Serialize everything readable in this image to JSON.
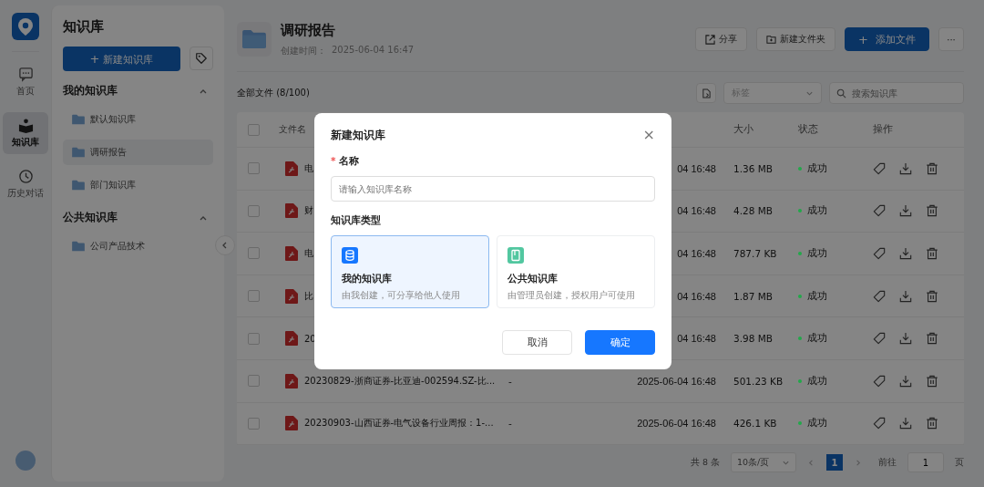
{
  "rail": {
    "items": [
      {
        "label": "首页",
        "selected": false
      },
      {
        "label": "知识库",
        "selected": true
      },
      {
        "label": "历史对话",
        "selected": false
      }
    ]
  },
  "sidebar": {
    "title": "知识库",
    "new_button": "新建知识库",
    "plus": "+",
    "groups": [
      {
        "title": "我的知识库",
        "expanded": true,
        "items": [
          {
            "label": "默认知识库",
            "selected": false
          },
          {
            "label": "调研报告",
            "selected": true
          },
          {
            "label": "部门知识库",
            "selected": false
          }
        ]
      },
      {
        "title": "公共知识库",
        "expanded": true,
        "items": [
          {
            "label": "公司产品技术",
            "selected": false
          }
        ]
      }
    ]
  },
  "header": {
    "title": "调研报告",
    "created_label": "创建时间：",
    "created": "2025-06-04 16:47",
    "share": "分享",
    "new_folder": "新建文件夹",
    "add_file": "添加文件",
    "plus": "+",
    "more": "···"
  },
  "toolbar": {
    "count": "全部文件 (8/100)",
    "tag_select": {
      "placeholder": "标签"
    },
    "search": {
      "placeholder": "搜索知识库"
    }
  },
  "table": {
    "columns": [
      "文件名",
      "大小",
      "状态",
      "操作"
    ],
    "header_checked": false,
    "rows": [
      {
        "checked": false,
        "name": "电",
        "date": "04 16:48",
        "size": "1.36 MB",
        "status": "成功",
        "color": "#22a84a"
      },
      {
        "checked": false,
        "name": "财",
        "date": "04 16:48",
        "size": "4.28 MB",
        "status": "成功",
        "color": "#22a84a"
      },
      {
        "checked": false,
        "name": "电",
        "date": "04 16:48",
        "size": "787.7 KB",
        "status": "成功",
        "color": "#22a84a"
      },
      {
        "checked": false,
        "name": "比",
        "date": "04 16:48",
        "size": "1.87 MB",
        "status": "成功",
        "color": "#22a84a"
      },
      {
        "checked": false,
        "name": "20",
        "date": "04 16:48",
        "size": "3.98 MB",
        "status": "成功",
        "color": "#22a84a"
      },
      {
        "checked": false,
        "name": "20230829-浙商证券-比亚迪-002594.SZ-比...",
        "column_2": "-",
        "date": "2025-06-04 16:48",
        "size": "501.23 KB",
        "status": "成功",
        "color": "#22a84a"
      },
      {
        "checked": false,
        "name": "20230903-山西证券-电气设备行业周报：1-...",
        "column_2": "-",
        "date": "2025-06-04 16:48",
        "size": "426.1 KB",
        "status": "成功",
        "color": "#22a84a"
      }
    ]
  },
  "pagination": {
    "total": "共 8 条",
    "page_size": "10条/页",
    "pages": [
      {
        "label": "1",
        "selected": true
      }
    ],
    "goto_label": "前往",
    "goto_value": "1",
    "page_unit": "页"
  },
  "modal": {
    "title": "新建知识库",
    "close": "×",
    "name_label": "名称",
    "required_mark": "*",
    "name_placeholder": "请输入知识库名称",
    "type_label": "知识库类型",
    "options": [
      {
        "kind": "database",
        "title": "我的知识库",
        "description": "由我创建，可分享给他人使用",
        "selected": true
      },
      {
        "kind": "book",
        "title": "公共知识库",
        "description": "由管理员创建，授权用户可使用",
        "selected": false
      }
    ],
    "cancel": "取消",
    "confirm": "确定"
  }
}
